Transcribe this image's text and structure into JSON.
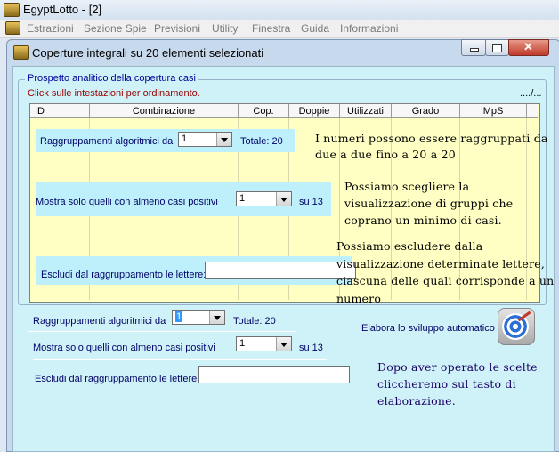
{
  "app": {
    "title": "EgyptLotto - [2]",
    "icon": "app-icon"
  },
  "menu": {
    "items": [
      "Estrazioni",
      "Sezione Spie",
      "Previsioni",
      "Utility",
      "Finestra",
      "Guida",
      "Informazioni"
    ]
  },
  "window": {
    "title": "Coperture integrali su 20 elementi selezionati",
    "buttons": [
      "minimize-icon",
      "maximize-icon",
      "close-icon"
    ]
  },
  "group": {
    "title": "Prospetto analitico della copertura casi",
    "hint": "Click sulle intestazioni per ordinamento.",
    "more": "..../...",
    "columns": [
      "ID",
      "Combinazione",
      "Cop.",
      "Doppie",
      "Utilizzati",
      "Grado",
      "MpS"
    ]
  },
  "overlay": {
    "grouping_label": "Raggruppamenti algoritmici da",
    "grouping_value": "1",
    "total_label": "Totale: 20",
    "positive_label": "Mostra solo quelli con almeno casi positivi",
    "positive_value": "1",
    "positive_suffix": "su 13",
    "exclude_label": "Escludi dal raggruppamento le lettere:",
    "exclude_value": ""
  },
  "bottom": {
    "grouping_label": "Raggruppamenti algoritmici da",
    "grouping_value": "1",
    "total_label": "Totale: 20",
    "positive_label": "Mostra solo quelli con almeno casi positivi",
    "positive_value": "1",
    "positive_suffix": "su 13",
    "exclude_label": "Escludi dal raggruppamento le lettere:",
    "exclude_value": "",
    "auto_label": "Elabora lo sviluppo automatico"
  },
  "annotations": {
    "note1_line1": "I numeri possono essere raggruppati da",
    "note1_line2": "due a due fino a 20 a 20",
    "note2_line1": "Possiamo scegliere la",
    "note2_line2": "visualizzazione di gruppi che",
    "note2_line3": "coprano un minimo di casi.",
    "note3_line1": "Possiamo escludere dalla",
    "note3_line2": "visualizzazione determinate lettere,",
    "note3_line3": "ciascuna delle quali corrisponde a un",
    "note3_line4": "numero",
    "note4_line1": "Dopo aver operato le scelte",
    "note4_line2": "cliccheremo sul tasto di",
    "note4_line3": "elaborazione."
  }
}
